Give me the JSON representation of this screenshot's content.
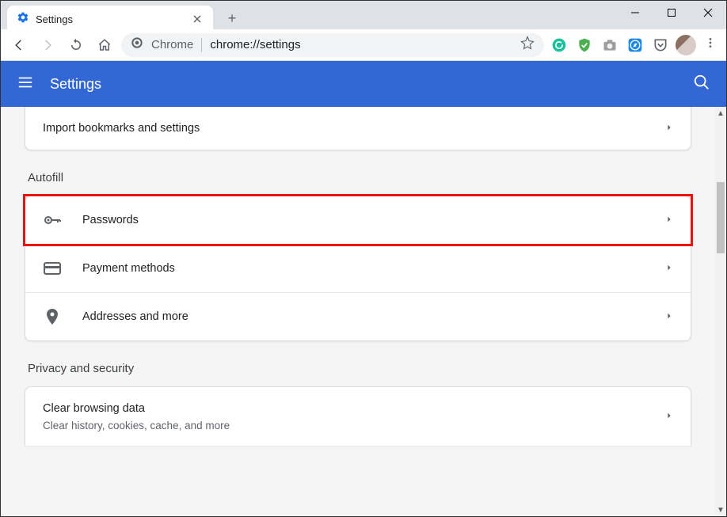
{
  "window": {
    "tab_title": "Settings"
  },
  "toolbar": {
    "url_prefix": "Chrome",
    "url_path": "chrome://settings"
  },
  "appbar": {
    "title": "Settings"
  },
  "main": {
    "import_row": "Import bookmarks and settings",
    "sections": {
      "autofill": {
        "title": "Autofill",
        "passwords": "Passwords",
        "payment": "Payment methods",
        "addresses": "Addresses and more"
      },
      "privacy": {
        "title": "Privacy and security",
        "clear_title": "Clear browsing data",
        "clear_sub": "Clear history, cookies, cache, and more"
      }
    }
  }
}
